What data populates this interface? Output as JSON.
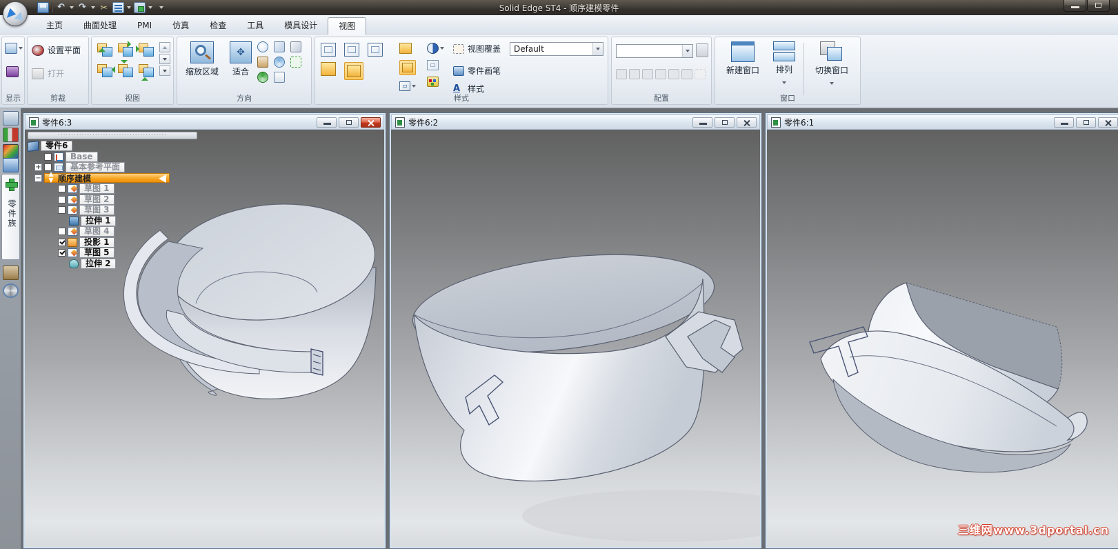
{
  "app": {
    "title": "Solid Edge ST4 - 顺序建模零件"
  },
  "quick_access": {
    "icons": [
      "save",
      "undo",
      "redo",
      "attach",
      "named-views",
      "save-view",
      "customize"
    ]
  },
  "tabs": [
    "主页",
    "曲面处理",
    "PMI",
    "仿真",
    "检查",
    "工具",
    "模具设计",
    "视图"
  ],
  "active_tab": "视图",
  "ribbon": {
    "display_group": {
      "label": "显示"
    },
    "clip_group": {
      "label": "剪裁",
      "set_plane": "设置平面",
      "open": "打开"
    },
    "view_group": {
      "label": "视图"
    },
    "orient_group": {
      "label": "方向",
      "zoom_area": "缩放区域",
      "fit": "适合"
    },
    "style_group": {
      "label": "样式",
      "view_override": "视图覆盖",
      "part_painter": "零件画笔",
      "styles": "样式",
      "override_value": "Default"
    },
    "config_group": {
      "label": "配置",
      "combo_value": ""
    },
    "window_group": {
      "label": "窗口",
      "new_window": "新建窗口",
      "arrange": "排列",
      "switch_window": "切换窗口"
    }
  },
  "dock": {
    "tab_label": "零件族"
  },
  "mdi": {
    "windows": [
      {
        "title": "零件6:3"
      },
      {
        "title": "零件6:2"
      },
      {
        "title": "零件6:1"
      }
    ]
  },
  "pathfinder": {
    "root": "零件6",
    "items": [
      {
        "label": "Base"
      },
      {
        "label": "基本参考平面"
      },
      {
        "label": "顺序建模"
      },
      {
        "label": "草图 1"
      },
      {
        "label": "草图 2"
      },
      {
        "label": "草图 3"
      },
      {
        "label": "拉伸 1"
      },
      {
        "label": "草图 4"
      },
      {
        "label": "投影 1"
      },
      {
        "label": "草图 5"
      },
      {
        "label": "拉伸 2"
      }
    ]
  },
  "watermark": "三维网www.3dportal.cn"
}
